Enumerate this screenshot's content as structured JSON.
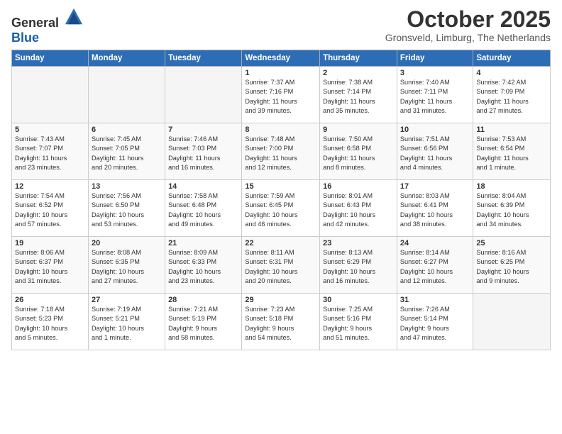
{
  "logo": {
    "general": "General",
    "blue": "Blue"
  },
  "title": "October 2025",
  "subtitle": "Gronsveld, Limburg, The Netherlands",
  "weekdays": [
    "Sunday",
    "Monday",
    "Tuesday",
    "Wednesday",
    "Thursday",
    "Friday",
    "Saturday"
  ],
  "weeks": [
    [
      {
        "day": "",
        "info": ""
      },
      {
        "day": "",
        "info": ""
      },
      {
        "day": "",
        "info": ""
      },
      {
        "day": "1",
        "info": "Sunrise: 7:37 AM\nSunset: 7:16 PM\nDaylight: 11 hours\nand 39 minutes."
      },
      {
        "day": "2",
        "info": "Sunrise: 7:38 AM\nSunset: 7:14 PM\nDaylight: 11 hours\nand 35 minutes."
      },
      {
        "day": "3",
        "info": "Sunrise: 7:40 AM\nSunset: 7:11 PM\nDaylight: 11 hours\nand 31 minutes."
      },
      {
        "day": "4",
        "info": "Sunrise: 7:42 AM\nSunset: 7:09 PM\nDaylight: 11 hours\nand 27 minutes."
      }
    ],
    [
      {
        "day": "5",
        "info": "Sunrise: 7:43 AM\nSunset: 7:07 PM\nDaylight: 11 hours\nand 23 minutes."
      },
      {
        "day": "6",
        "info": "Sunrise: 7:45 AM\nSunset: 7:05 PM\nDaylight: 11 hours\nand 20 minutes."
      },
      {
        "day": "7",
        "info": "Sunrise: 7:46 AM\nSunset: 7:03 PM\nDaylight: 11 hours\nand 16 minutes."
      },
      {
        "day": "8",
        "info": "Sunrise: 7:48 AM\nSunset: 7:00 PM\nDaylight: 11 hours\nand 12 minutes."
      },
      {
        "day": "9",
        "info": "Sunrise: 7:50 AM\nSunset: 6:58 PM\nDaylight: 11 hours\nand 8 minutes."
      },
      {
        "day": "10",
        "info": "Sunrise: 7:51 AM\nSunset: 6:56 PM\nDaylight: 11 hours\nand 4 minutes."
      },
      {
        "day": "11",
        "info": "Sunrise: 7:53 AM\nSunset: 6:54 PM\nDaylight: 11 hours\nand 1 minute."
      }
    ],
    [
      {
        "day": "12",
        "info": "Sunrise: 7:54 AM\nSunset: 6:52 PM\nDaylight: 10 hours\nand 57 minutes."
      },
      {
        "day": "13",
        "info": "Sunrise: 7:56 AM\nSunset: 6:50 PM\nDaylight: 10 hours\nand 53 minutes."
      },
      {
        "day": "14",
        "info": "Sunrise: 7:58 AM\nSunset: 6:48 PM\nDaylight: 10 hours\nand 49 minutes."
      },
      {
        "day": "15",
        "info": "Sunrise: 7:59 AM\nSunset: 6:45 PM\nDaylight: 10 hours\nand 46 minutes."
      },
      {
        "day": "16",
        "info": "Sunrise: 8:01 AM\nSunset: 6:43 PM\nDaylight: 10 hours\nand 42 minutes."
      },
      {
        "day": "17",
        "info": "Sunrise: 8:03 AM\nSunset: 6:41 PM\nDaylight: 10 hours\nand 38 minutes."
      },
      {
        "day": "18",
        "info": "Sunrise: 8:04 AM\nSunset: 6:39 PM\nDaylight: 10 hours\nand 34 minutes."
      }
    ],
    [
      {
        "day": "19",
        "info": "Sunrise: 8:06 AM\nSunset: 6:37 PM\nDaylight: 10 hours\nand 31 minutes."
      },
      {
        "day": "20",
        "info": "Sunrise: 8:08 AM\nSunset: 6:35 PM\nDaylight: 10 hours\nand 27 minutes."
      },
      {
        "day": "21",
        "info": "Sunrise: 8:09 AM\nSunset: 6:33 PM\nDaylight: 10 hours\nand 23 minutes."
      },
      {
        "day": "22",
        "info": "Sunrise: 8:11 AM\nSunset: 6:31 PM\nDaylight: 10 hours\nand 20 minutes."
      },
      {
        "day": "23",
        "info": "Sunrise: 8:13 AM\nSunset: 6:29 PM\nDaylight: 10 hours\nand 16 minutes."
      },
      {
        "day": "24",
        "info": "Sunrise: 8:14 AM\nSunset: 6:27 PM\nDaylight: 10 hours\nand 12 minutes."
      },
      {
        "day": "25",
        "info": "Sunrise: 8:16 AM\nSunset: 6:25 PM\nDaylight: 10 hours\nand 9 minutes."
      }
    ],
    [
      {
        "day": "26",
        "info": "Sunrise: 7:18 AM\nSunset: 5:23 PM\nDaylight: 10 hours\nand 5 minutes."
      },
      {
        "day": "27",
        "info": "Sunrise: 7:19 AM\nSunset: 5:21 PM\nDaylight: 10 hours\nand 1 minute."
      },
      {
        "day": "28",
        "info": "Sunrise: 7:21 AM\nSunset: 5:19 PM\nDaylight: 9 hours\nand 58 minutes."
      },
      {
        "day": "29",
        "info": "Sunrise: 7:23 AM\nSunset: 5:18 PM\nDaylight: 9 hours\nand 54 minutes."
      },
      {
        "day": "30",
        "info": "Sunrise: 7:25 AM\nSunset: 5:16 PM\nDaylight: 9 hours\nand 51 minutes."
      },
      {
        "day": "31",
        "info": "Sunrise: 7:26 AM\nSunset: 5:14 PM\nDaylight: 9 hours\nand 47 minutes."
      },
      {
        "day": "",
        "info": ""
      }
    ]
  ]
}
